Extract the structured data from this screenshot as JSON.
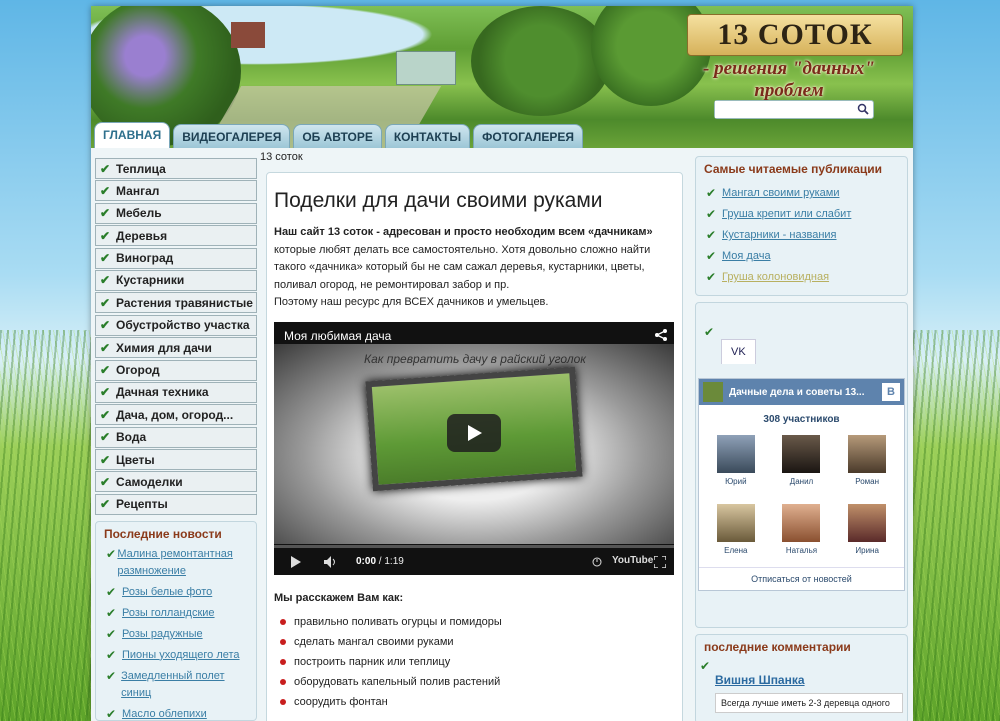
{
  "header": {
    "logo": "13 СОТОК",
    "slogan": "- решения \"дачных\" проблем",
    "search": {
      "value": "",
      "placeholder": ""
    }
  },
  "tabs": [
    "ГЛАВНАЯ",
    "ВИДЕОГАЛЕРЕЯ",
    "ОБ АВТОРЕ",
    "КОНТАКТЫ",
    "ФОТОГАЛЕРЕЯ"
  ],
  "breadcrumb": "13 соток",
  "left_menu": [
    "Теплица",
    "Мангал",
    "Мебель",
    "Деревья",
    "Виноград",
    "Кустарники",
    "Растения травянистые",
    "Обустройство участка",
    "Химия для дачи",
    "Огород",
    "Дачная техника",
    "Дача, дом, огород...",
    "Вода",
    "Цветы",
    "Самоделки",
    "Рецепты"
  ],
  "news": {
    "title": "Последние новости",
    "items": [
      "Малина ремонтантная размножение",
      "Розы белые фото",
      "Розы голландские",
      "Розы радужные",
      "Пионы уходящего лета",
      "Замедленный полет синиц",
      "Масло облепихи"
    ]
  },
  "main": {
    "title": "Поделки для дачи своими руками",
    "intro_bold": "Наш сайт 13 соток - адресован и просто необходим всем «дачникам»",
    "intro_rest": " которые любят делать все самостоятельно. Хотя довольно сложно найти такого «дачника» который бы не сам сажал деревья, кустарники, цветы, поливал огород, не ремонтировал забор и пр.",
    "intro_2": "Поэтому наш ресурс для ВСЕХ дачников и умельцев.",
    "video": {
      "title": "Моя любимая дача",
      "caption": "Как превратить дачу в райский уголок",
      "time_current": "0:00",
      "time_total": " / 1:19"
    },
    "list_head": "Мы расскажем Вам как:",
    "list": [
      "правильно поливать огурцы и помидоры",
      "сделать мангал своими руками",
      "построить парник или теплицу",
      "оборудовать капельный полив растений",
      "соорудить фонтан"
    ]
  },
  "popular": {
    "title": "Самые читаемые публикации",
    "items": [
      "Мангал своими руками",
      "Груша крепит или слабит",
      "Кустарники - названия",
      "Моя дача",
      "Груша колоновидная"
    ]
  },
  "vk": {
    "tab": "VK",
    "group": "Дачные дела и советы 13...",
    "members_count": "308 участников",
    "members": [
      "Юрий",
      "Данил",
      "Роман",
      "Елена",
      "Наталья",
      "Ирина"
    ],
    "unsubscribe": "Отписаться от новостей"
  },
  "comments": {
    "title": "последние комментарии",
    "item_title": "Вишня Шпанка",
    "item_text": "Всегда лучше иметь 2-3 деревца одного"
  },
  "colors": {
    "accent": "#3a7ea5",
    "heading": "#8a3a1a",
    "check": "#2a7e2a",
    "bullet": "#c81e1e"
  }
}
